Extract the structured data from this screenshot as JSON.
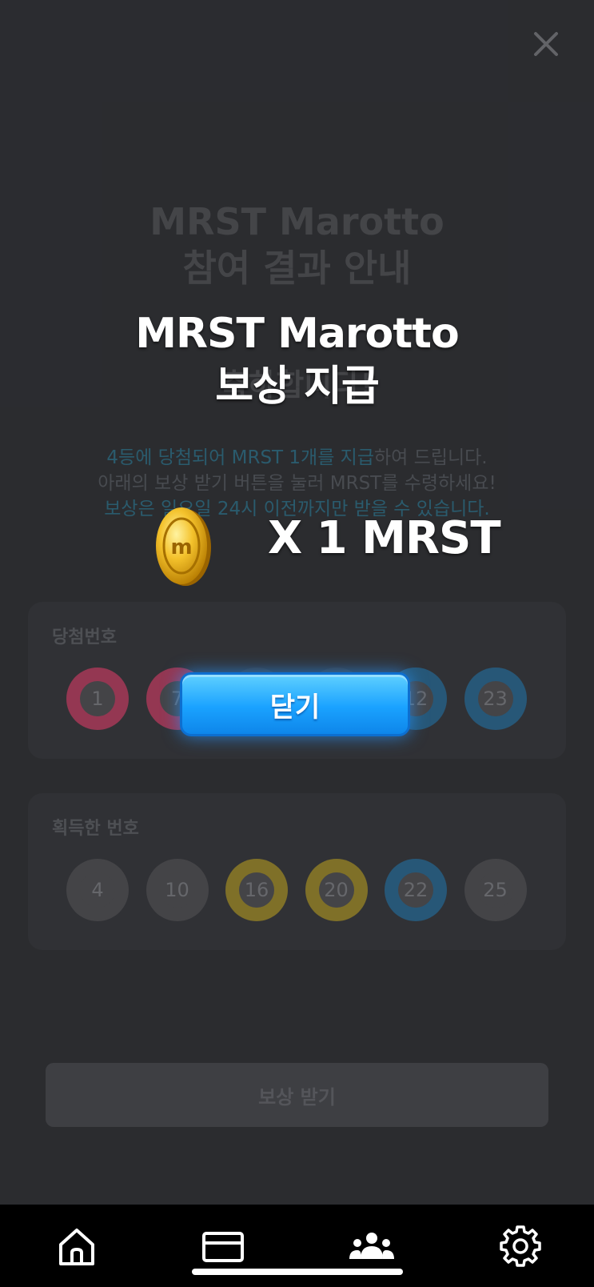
{
  "background": {
    "title_line1": "MRST Marotto",
    "title_line2": "참여 결과 안내",
    "subtitle_partial": "축하합니다!",
    "info": {
      "line1_prefix": "4등에 당첨되어 MRST 1개를 지급",
      "line1_suffix": "하여 드립니다.",
      "line2": "아래의 보상 받기 버튼을 눌러 MRST를 수령하세요!",
      "line3": "보상은 일요일 24시 이전까지만 받을 수 있습니다."
    },
    "winning_card": {
      "title": "당첨번호",
      "balls": [
        {
          "number": "1",
          "color": "#a13c59"
        },
        {
          "number": "7",
          "color": "#a13c59"
        },
        {
          "number": "",
          "color": "#3d3e42"
        },
        {
          "number": "",
          "color": "#3d3e42"
        },
        {
          "number": "12",
          "color": "#2b5f82"
        },
        {
          "number": "23",
          "color": "#2b5f82"
        }
      ]
    },
    "acquired_card": {
      "title": "획득한 번호",
      "balls": [
        {
          "number": "4",
          "color": "#4a4a4e"
        },
        {
          "number": "10",
          "color": "#4a4a4e"
        },
        {
          "number": "16",
          "color": "#8a7a2c"
        },
        {
          "number": "20",
          "color": "#8a7a2c"
        },
        {
          "number": "22",
          "color": "#2b5f82"
        },
        {
          "number": "25",
          "color": "#4a4a4e"
        }
      ]
    },
    "claim_button": "보상 받기"
  },
  "popup": {
    "title_line1": "MRST Marotto",
    "title_line2": "보상 지급",
    "reward_text": "X 1 MRST",
    "coin_icon": "mrst-gold-coin",
    "close_button": "닫기"
  },
  "bottom_nav": {
    "items": [
      "home-icon",
      "card-icon",
      "community-icon",
      "settings-icon"
    ]
  }
}
